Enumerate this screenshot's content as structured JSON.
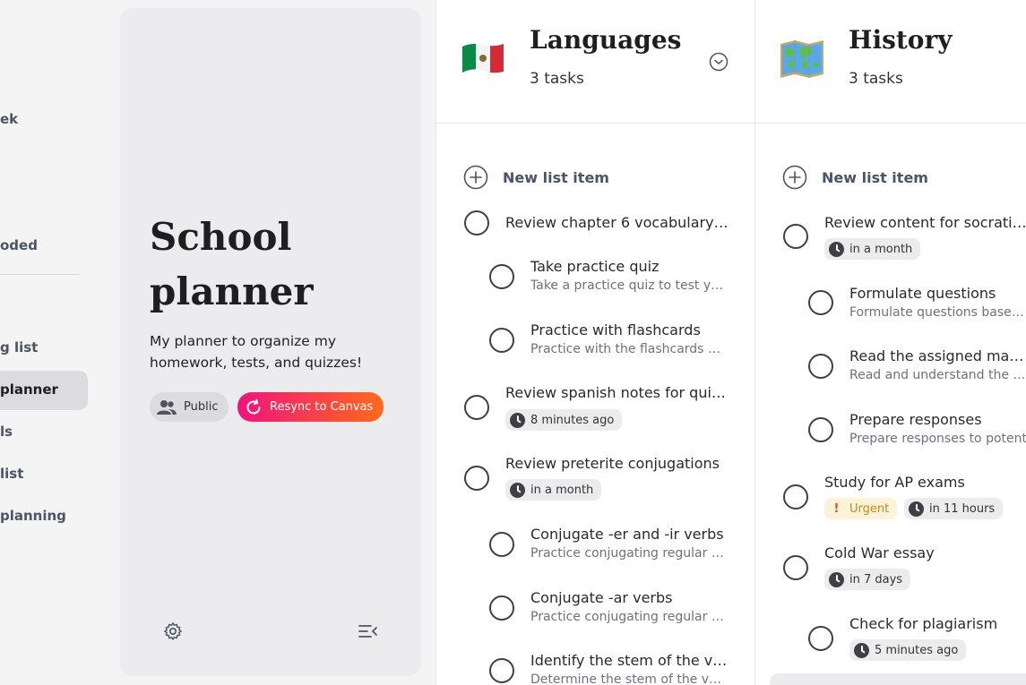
{
  "sidebar": {
    "items": [
      {
        "label": "ek"
      },
      {
        "label": "oded"
      },
      {
        "label": "g list"
      },
      {
        "label": "planner"
      },
      {
        "label": "ls"
      },
      {
        "label": "list"
      },
      {
        "label": "planning"
      }
    ]
  },
  "planner": {
    "title": "School planner",
    "description": "My planner to organize my homework, tests, and quizzes!",
    "visibility_label": "Public",
    "resync_label": "Resync to Canvas"
  },
  "columns": [
    {
      "emoji": "mexico-flag",
      "title": "Languages",
      "count": "3 tasks",
      "new_item_label": "New list item",
      "tasks": [
        {
          "title": "Review chapter 6 vocabulary (…"
        },
        {
          "title": "Take practice quiz",
          "desc": "Take a practice quiz to test yo…"
        },
        {
          "title": "Practice with flashcards",
          "desc": "Practice with the flashcards u…"
        },
        {
          "title": "Review spanish notes for quiz …",
          "due": "8 minutes ago"
        },
        {
          "title": "Review preterite conjugations",
          "due": "in a month"
        },
        {
          "title": "Conjugate -er and -ir verbs",
          "desc": "Practice conjugating regular -…"
        },
        {
          "title": "Conjugate -ar verbs",
          "desc": "Practice conjugating regular -…"
        },
        {
          "title": "Identify the stem of the ve…",
          "desc": "Determine the stem of the ver…"
        }
      ]
    },
    {
      "emoji": "world-map",
      "title": "History",
      "count": "3 tasks",
      "new_item_label": "New list item",
      "tasks": [
        {
          "title": "Review content for socratic s",
          "due": "in a month"
        },
        {
          "title": "Formulate questions",
          "desc": "Formulate questions based c"
        },
        {
          "title": "Read the assigned materi",
          "desc": "Read and understand the ass"
        },
        {
          "title": "Prepare responses",
          "desc": "Prepare responses to potent"
        },
        {
          "title": "Study for AP exams",
          "urgent": "Urgent",
          "due": "in 11 hours"
        },
        {
          "title": "Cold War essay",
          "due": "in 7 days"
        },
        {
          "title": "Check for plagiarism",
          "due": "5 minutes ago"
        }
      ]
    }
  ],
  "colors": {
    "accent_start": "#f0147c",
    "accent_end": "#ff6a1a",
    "urgent_text": "#c2891a",
    "urgent_bg": "#fdf3d9"
  }
}
